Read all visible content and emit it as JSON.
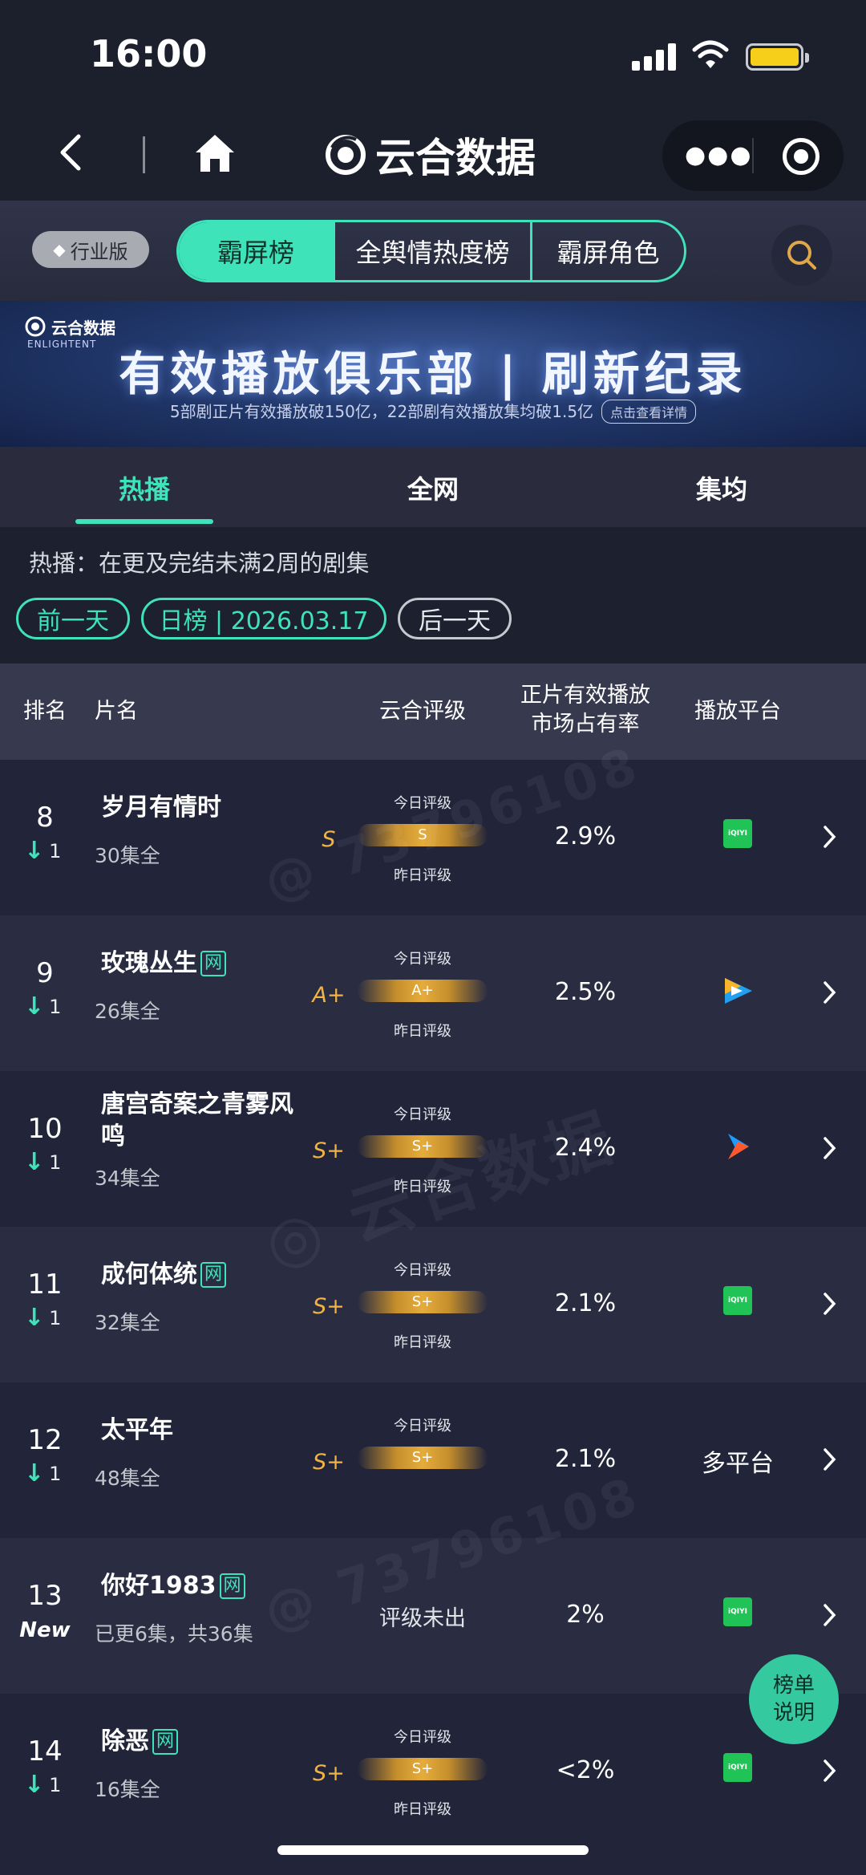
{
  "status": {
    "time": "16:00"
  },
  "app": {
    "brand": "云合数据"
  },
  "toolbar": {
    "industry": "行业版",
    "segments": [
      "霸屏榜",
      "全舆情热度榜",
      "霸屏角色"
    ]
  },
  "banner": {
    "logo_cn": "云合数据",
    "logo_en": "ENLIGHTENT",
    "title": "有效播放俱乐部 | 刷新纪录",
    "subtitle": "5部剧正片有效播放破150亿，22部剧有效播放集均破1.5亿",
    "button": "点击查看详情"
  },
  "tabs": [
    "热播",
    "全网",
    "集均"
  ],
  "filter": {
    "description": "热播：在更及完结未满2周的剧集",
    "prev": "前一天",
    "date": "日榜 | 2026.03.17",
    "next": "后一天"
  },
  "table": {
    "headers": {
      "rank": "排名",
      "title": "片名",
      "grade": "云合评级",
      "share_1": "正片有效播放",
      "share_2": "市场占有率",
      "platform": "播放平台"
    },
    "today_label": "今日评级",
    "yesterday_label": "昨日评级",
    "rows": [
      {
        "rank": "8",
        "change": "1",
        "title": "岁月有情时",
        "net": "",
        "eps": "30集全",
        "side": "S",
        "grade": "S",
        "share": "2.9%",
        "platform": "iqiyi"
      },
      {
        "rank": "9",
        "change": "1",
        "title": "玫瑰丛生",
        "net": "网",
        "eps": "26集全",
        "side": "A+",
        "grade": "A+",
        "share": "2.5%",
        "platform": "tencent"
      },
      {
        "rank": "10",
        "change": "1",
        "title": "唐宫奇案之青雾风鸣",
        "net": "",
        "eps": "34集全",
        "side": "S+",
        "grade": "S+",
        "share": "2.4%",
        "platform": "youku"
      },
      {
        "rank": "11",
        "change": "1",
        "title": "成何体统",
        "net": "网",
        "eps": "32集全",
        "side": "S+",
        "grade": "S+",
        "share": "2.1%",
        "platform": "iqiyi"
      },
      {
        "rank": "12",
        "change": "1",
        "title": "太平年",
        "net": "",
        "eps": "48集全",
        "side": "S+",
        "grade": "S+",
        "share": "2.1%",
        "platform_text": "多平台"
      },
      {
        "rank": "13",
        "new": "New",
        "title": "你好1983",
        "net": "网",
        "eps": "已更6集，共36集",
        "pending": "评级未出",
        "share": "2%",
        "platform": "iqiyi"
      },
      {
        "rank": "14",
        "change": "1",
        "title": "除恶",
        "net": "网",
        "eps": "16集全",
        "side": "S+",
        "grade": "S+",
        "share": "<2%",
        "platform": "iqiyi"
      }
    ]
  },
  "fab": {
    "line1": "榜单",
    "line2": "说明"
  },
  "colors": {
    "accent": "#3ee3b9",
    "grade": "#f1b443",
    "background": "#1b1e2b"
  }
}
